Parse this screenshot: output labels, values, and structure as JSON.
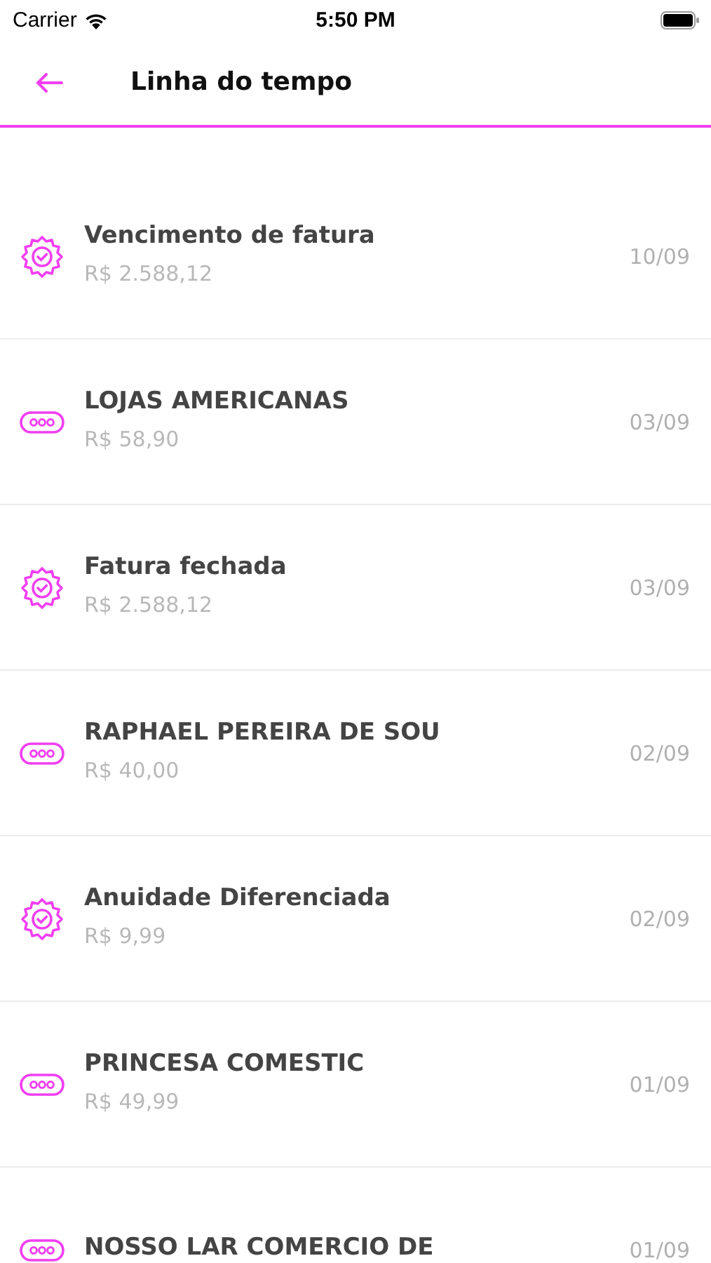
{
  "status_bar": {
    "carrier": "Carrier",
    "time": "5:50 PM"
  },
  "header": {
    "title": "Linha do tempo"
  },
  "events": [
    {
      "kind": "bill",
      "title": "Vencimento de fatura",
      "amount": "R$ 2.588,12",
      "date": "10/09"
    },
    {
      "kind": "purchase",
      "title": "LOJAS AMERICANAS",
      "amount": "R$ 58,90",
      "date": "03/09"
    },
    {
      "kind": "bill",
      "title": "Fatura fechada",
      "amount": "R$ 2.588,12",
      "date": "03/09"
    },
    {
      "kind": "purchase",
      "title": "RAPHAEL PEREIRA DE SOU",
      "amount": "R$ 40,00",
      "date": "02/09"
    },
    {
      "kind": "bill",
      "title": "Anuidade Diferenciada",
      "amount": "R$ 9,99",
      "date": "02/09"
    },
    {
      "kind": "purchase",
      "title": "PRINCESA COMESTIC",
      "amount": "R$ 49,99",
      "date": "01/09"
    },
    {
      "kind": "purchase",
      "title": "NOSSO LAR COMERCIO DE",
      "date": "01/09"
    }
  ]
}
